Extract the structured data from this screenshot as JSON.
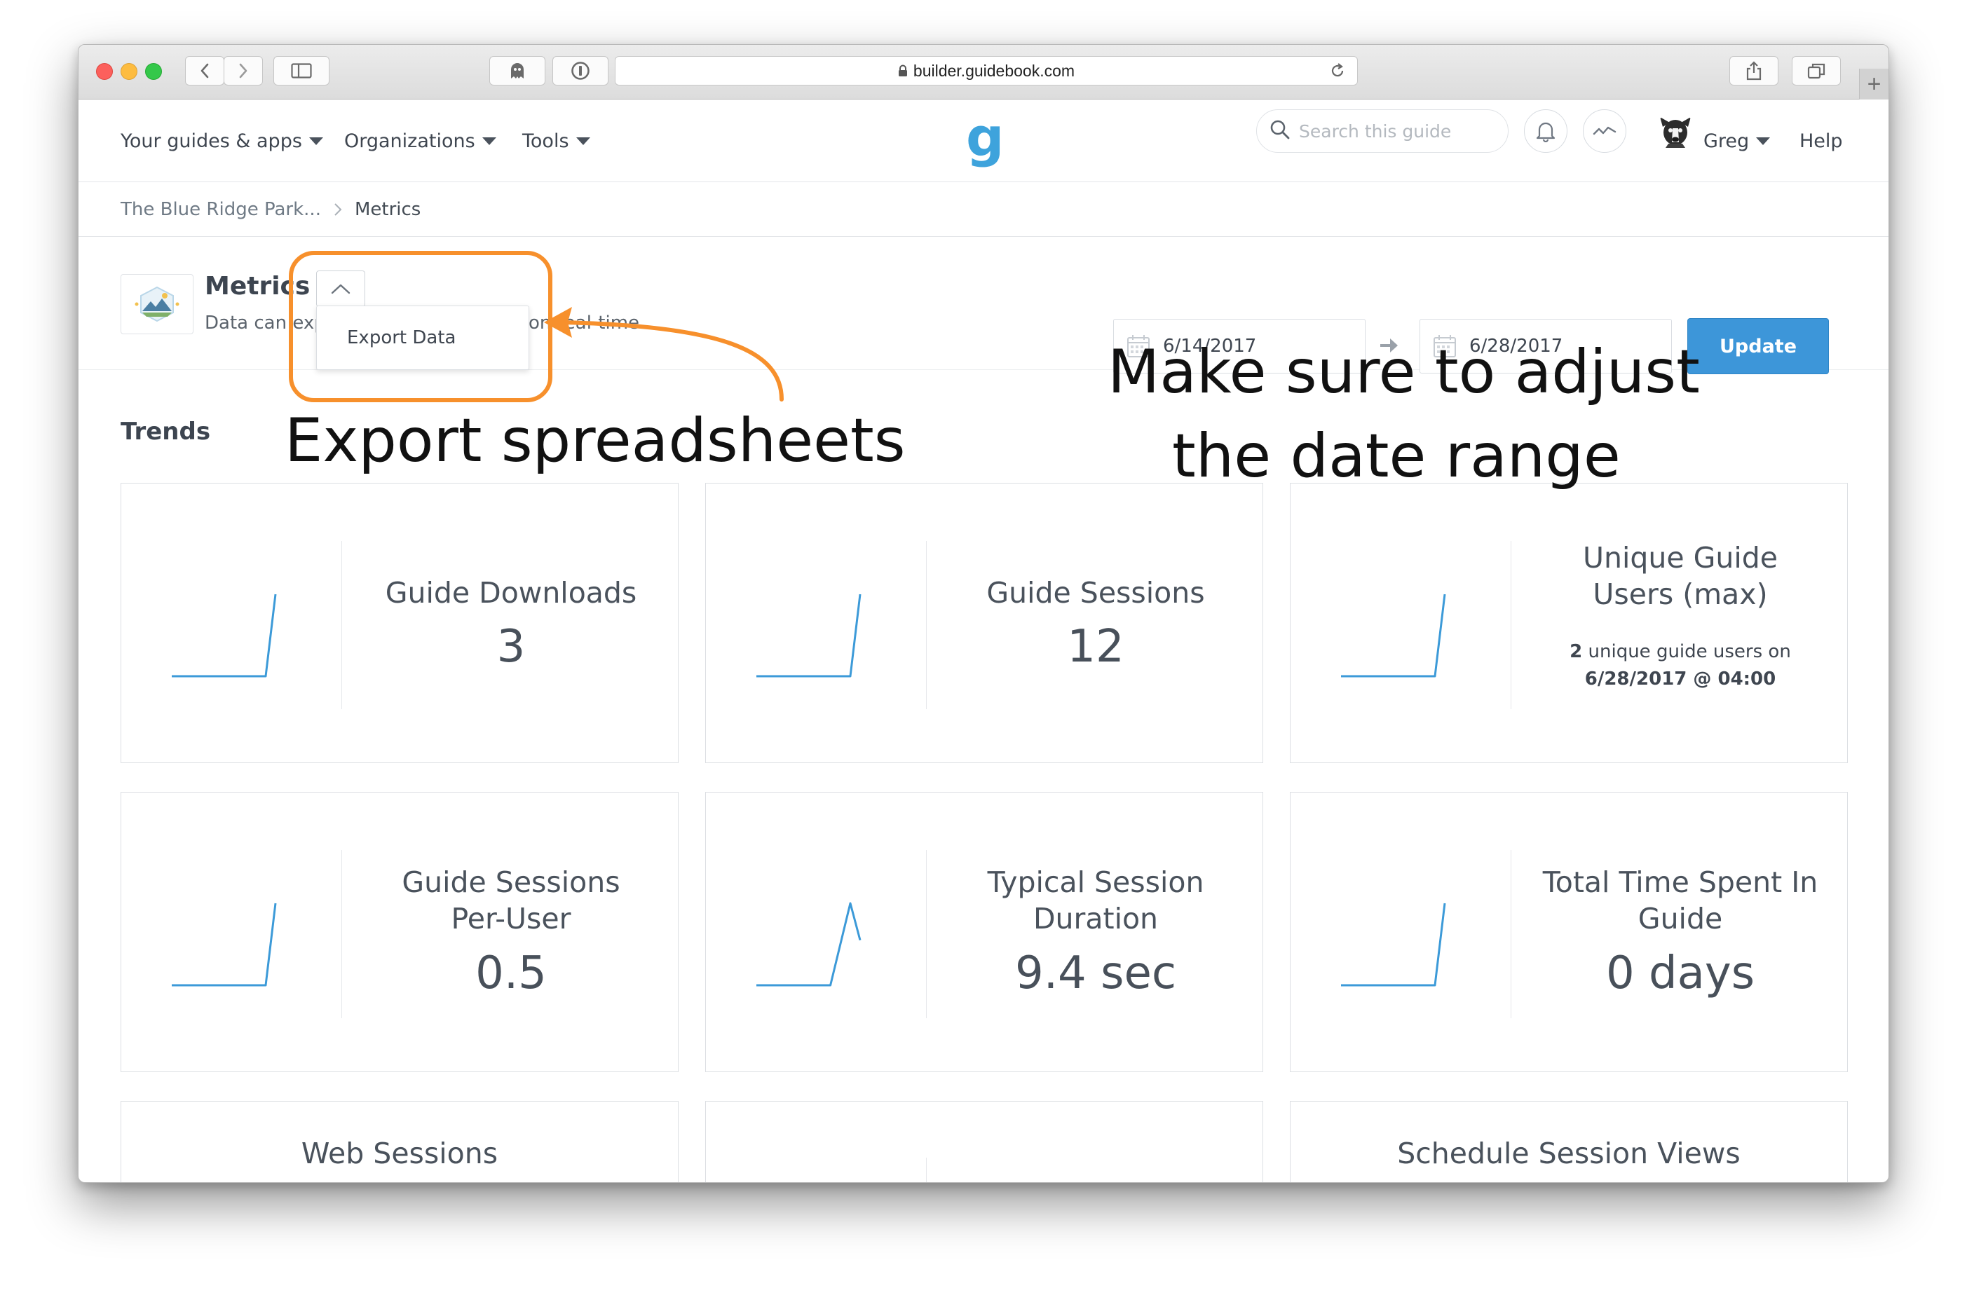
{
  "browser": {
    "url": "builder.guidebook.com"
  },
  "nav": {
    "items": [
      "Your guides & apps",
      "Organizations",
      "Tools"
    ],
    "logo": "g",
    "search_placeholder": "Search this guide",
    "user": "Greg",
    "help": "Help"
  },
  "breadcrumb": {
    "parent": "The Blue Ridge Park...",
    "current": "Metrics"
  },
  "header": {
    "title": "Metrics",
    "subtitle_left": "Data can exp",
    "subtitle_right": "on real-time.",
    "dropdown_item": "Export Data",
    "start_date": "6/14/2017",
    "end_date": "6/28/2017",
    "update_label": "Update"
  },
  "trends_label": "Trends",
  "cards": [
    {
      "title": "Guide Downloads",
      "value": "3",
      "sparkline": [
        0,
        0,
        0,
        0,
        0,
        0,
        1
      ]
    },
    {
      "title": "Guide Sessions",
      "value": "12",
      "sparkline": [
        0,
        0,
        0,
        0,
        0,
        0,
        1
      ]
    },
    {
      "title": "Unique Guide Users (max)",
      "detail_count": "2",
      "detail_text": "unique guide users on",
      "detail_time": "6/28/2017 @ 04:00",
      "sparkline": [
        0,
        0,
        0,
        0,
        0,
        0,
        1
      ]
    },
    {
      "title": "Guide Sessions Per-User",
      "value": "0.5",
      "sparkline": [
        0,
        0,
        0,
        0,
        0,
        0,
        1
      ]
    },
    {
      "title": "Typical Session Duration",
      "value": "9.4 sec",
      "sparkline": [
        0,
        0,
        0,
        0,
        0,
        1,
        0.55
      ]
    },
    {
      "title": "Total Time Spent In Guide",
      "value": "0 days",
      "sparkline": [
        0,
        0,
        0,
        0,
        0,
        0,
        1
      ]
    },
    {
      "title": "Web Sessions"
    },
    {
      "title": ""
    },
    {
      "title": "Schedule Session Views"
    }
  ],
  "annotations": {
    "export": "Export spreadsheets",
    "date_line1": "Make sure to adjust",
    "date_line2": "the date range"
  },
  "colors": {
    "accent": "#3d96d9",
    "sparkline": "#3c9ad8",
    "annotation": "#f7902c"
  }
}
